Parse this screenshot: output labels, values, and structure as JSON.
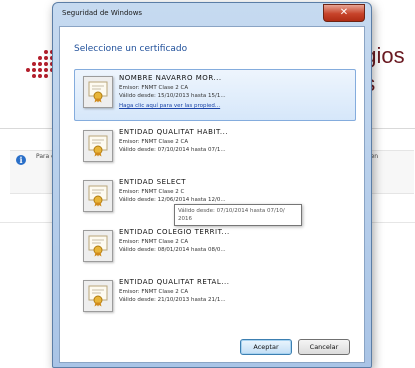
{
  "background": {
    "logo_text_line1": "egios",
    "logo_text_line2": "as",
    "info_text_left": "Para el equ",
    "info_text_right": "T en",
    "brand_color": "#b31f2c"
  },
  "dialog": {
    "title": "Seguridad de Windows",
    "close_label": "✕",
    "heading": "Seleccione un certificado",
    "certificates": [
      {
        "name": "NOMBRE NAVARRO MOR...",
        "issuer": "Emisor: FNMT Clase 2 CA",
        "valid": "Válido desde: 15/10/2013 hasta 15/1...",
        "link": "Haga clic aquí para ver las propied...",
        "selected": true
      },
      {
        "name": "ENTIDAD QUALITAT HABIT...",
        "issuer": "Emisor: FNMT Clase 2 CA",
        "valid": "Válido desde: 07/10/2014 hasta 07/1...",
        "selected": false
      },
      {
        "name": "ENTIDAD SELECT",
        "issuer": "Emisor: FNMT Clase 2 C",
        "valid": "Válido desde: 12/06/2014 hasta 12/0...",
        "selected": false
      },
      {
        "name": "ENTIDAD COLEGIO TERRIT...",
        "issuer": "Emisor: FNMT Clase 2 CA",
        "valid": "Válido desde: 08/01/2014 hasta 08/0...",
        "selected": false
      },
      {
        "name": "ENTIDAD QUALITAT RETAL...",
        "issuer": "Emisor: FNMT Clase 2 CA",
        "valid": "Válido desde: 21/10/2013 hasta 21/1...",
        "selected": false
      }
    ],
    "tooltip": "Válido desde: 07/10/2014 hasta 07/10/ 2016",
    "accept_label": "Aceptar",
    "cancel_label": "Cancelar"
  },
  "icons": {
    "certificate": "certificate-icon",
    "close": "close-icon",
    "info": "info-icon"
  }
}
